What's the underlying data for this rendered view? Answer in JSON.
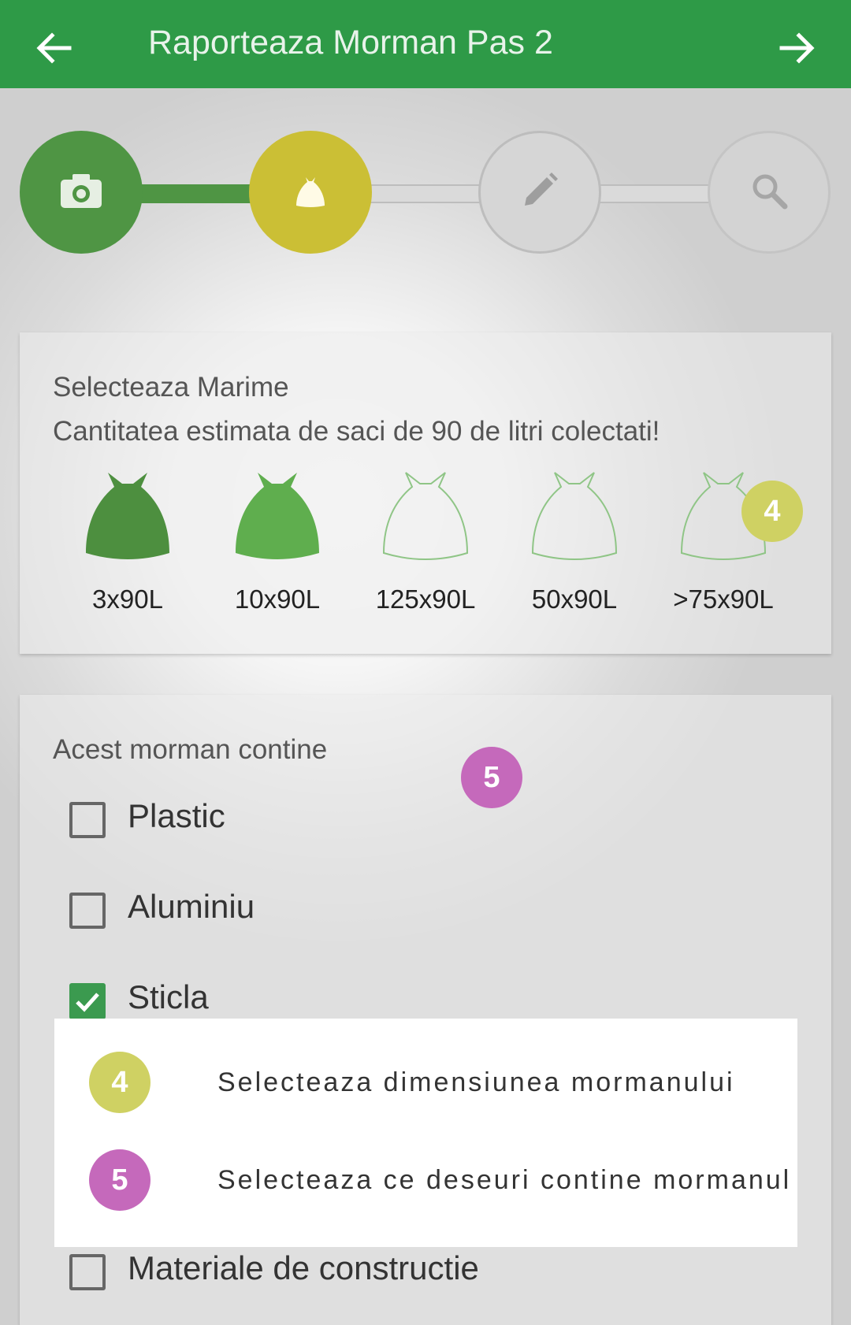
{
  "app_bar": {
    "title": "Raporteaza Morman Pas 2",
    "back_icon": "arrow-left-icon",
    "forward_icon": "arrow-right-icon",
    "color": "#2e9a47"
  },
  "stepper": {
    "steps": [
      {
        "icon": "camera-icon",
        "state": "completed",
        "color": "#4f9544"
      },
      {
        "icon": "trash-bag-icon",
        "state": "active",
        "color": "#cbbf35"
      },
      {
        "icon": "pencil-icon",
        "state": "pending"
      },
      {
        "icon": "search-icon",
        "state": "pending"
      }
    ]
  },
  "size_card": {
    "title": "Selecteaza Marime",
    "subtitle": "Cantitatea estimata de saci de 90 de litri colectati!",
    "options": [
      {
        "label": "3x90L",
        "selected": true
      },
      {
        "label": "10x90L",
        "selected": true
      },
      {
        "label": "125x90L",
        "selected": false
      },
      {
        "label": "50x90L",
        "selected": false
      },
      {
        "label": ">75x90L",
        "selected": false
      }
    ],
    "badge": "4"
  },
  "contents_card": {
    "title": "Acest morman contine",
    "badge": "5",
    "items": [
      {
        "label": "Plastic",
        "checked": false
      },
      {
        "label": "Aluminiu",
        "checked": false
      },
      {
        "label": "Sticla",
        "checked": true
      },
      {
        "label": "Materiale de constructie",
        "checked": false
      }
    ]
  },
  "legend": {
    "items": [
      {
        "number": "4",
        "text": "Selecteaza dimensiunea mormanului",
        "color": "#cfd163"
      },
      {
        "number": "5",
        "text": "Selecteaza ce deseuri contine mormanul",
        "color": "#c569bb"
      }
    ]
  }
}
